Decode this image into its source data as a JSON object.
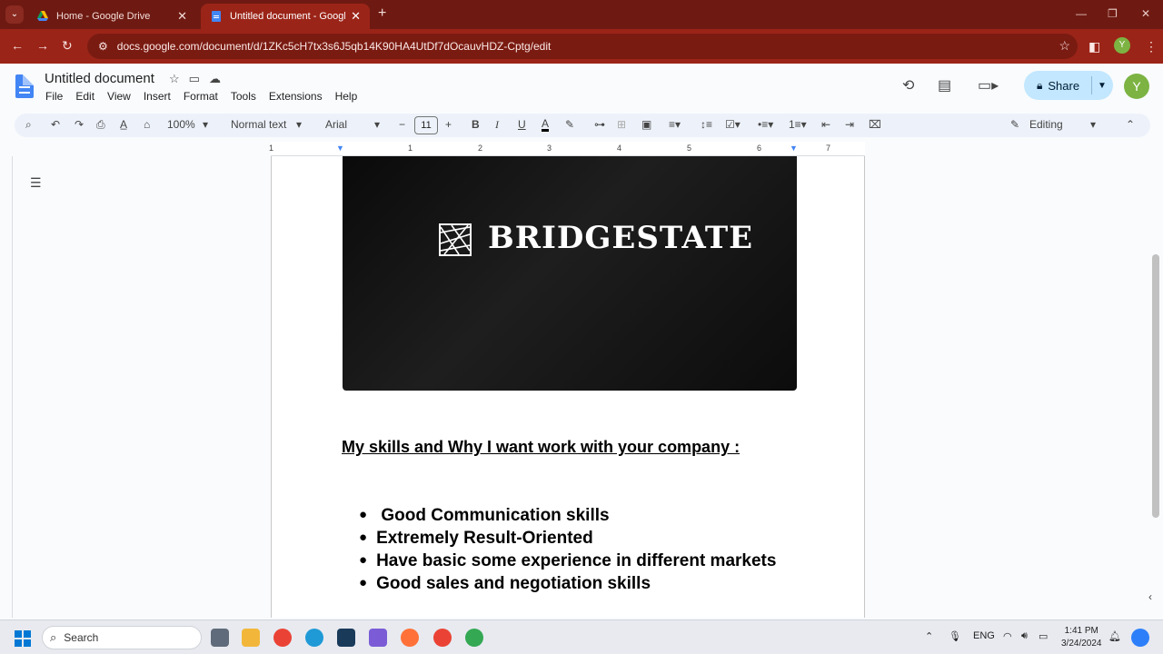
{
  "tabs": [
    {
      "title": "Home - Google Drive"
    },
    {
      "title": "Untitled document - Google Docs"
    }
  ],
  "address": {
    "url": "docs.google.com/document/d/1ZKc5cH7tx3s6J5qb14K90HA4UtDf7dOcauvHDZ-Cptg/edit"
  },
  "profile_initial": "Y",
  "doc": {
    "title": "Untitled document",
    "menu": [
      "File",
      "Edit",
      "View",
      "Insert",
      "Format",
      "Tools",
      "Extensions",
      "Help"
    ],
    "share_label": "Share",
    "mode_label": "Editing"
  },
  "toolbar": {
    "zoom": "100%",
    "style": "Normal text",
    "font": "Arial",
    "font_size": "11"
  },
  "ruler": [
    "1",
    "1",
    "2",
    "3",
    "4",
    "5",
    "6",
    "7"
  ],
  "content": {
    "logo_text": "BRIDGESTATE",
    "heading": "My skills and Why I want work with your company :",
    "bullets": [
      " Good Communication skills",
      "Extremely Result-Oriented",
      "Have basic some experience in different markets",
      "Good sales and negotiation skills"
    ]
  },
  "taskbar": {
    "search_placeholder": "Search",
    "lang": "ENG",
    "time": "1:41 PM",
    "date": "3/24/2024"
  },
  "colors": {
    "tabbar": "#6e1a12",
    "addressbar": "#9b2418",
    "share_bg": "#c2e7ff",
    "docs_blue": "#4285f4"
  }
}
